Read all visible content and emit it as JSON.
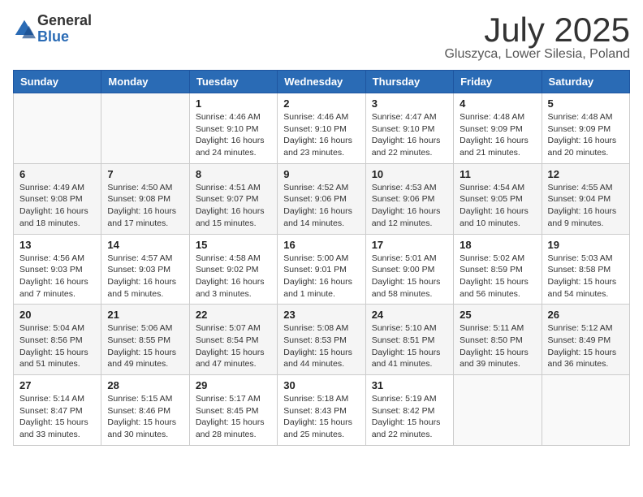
{
  "logo": {
    "general": "General",
    "blue": "Blue"
  },
  "title": "July 2025",
  "location": "Gluszyca, Lower Silesia, Poland",
  "days_of_week": [
    "Sunday",
    "Monday",
    "Tuesday",
    "Wednesday",
    "Thursday",
    "Friday",
    "Saturday"
  ],
  "weeks": [
    [
      {
        "day": "",
        "empty": true
      },
      {
        "day": "",
        "empty": true
      },
      {
        "day": "1",
        "sunrise": "4:46 AM",
        "sunset": "9:10 PM",
        "daylight": "16 hours and 24 minutes."
      },
      {
        "day": "2",
        "sunrise": "4:46 AM",
        "sunset": "9:10 PM",
        "daylight": "16 hours and 23 minutes."
      },
      {
        "day": "3",
        "sunrise": "4:47 AM",
        "sunset": "9:10 PM",
        "daylight": "16 hours and 22 minutes."
      },
      {
        "day": "4",
        "sunrise": "4:48 AM",
        "sunset": "9:09 PM",
        "daylight": "16 hours and 21 minutes."
      },
      {
        "day": "5",
        "sunrise": "4:48 AM",
        "sunset": "9:09 PM",
        "daylight": "16 hours and 20 minutes."
      }
    ],
    [
      {
        "day": "6",
        "sunrise": "4:49 AM",
        "sunset": "9:08 PM",
        "daylight": "16 hours and 18 minutes."
      },
      {
        "day": "7",
        "sunrise": "4:50 AM",
        "sunset": "9:08 PM",
        "daylight": "16 hours and 17 minutes."
      },
      {
        "day": "8",
        "sunrise": "4:51 AM",
        "sunset": "9:07 PM",
        "daylight": "16 hours and 15 minutes."
      },
      {
        "day": "9",
        "sunrise": "4:52 AM",
        "sunset": "9:06 PM",
        "daylight": "16 hours and 14 minutes."
      },
      {
        "day": "10",
        "sunrise": "4:53 AM",
        "sunset": "9:06 PM",
        "daylight": "16 hours and 12 minutes."
      },
      {
        "day": "11",
        "sunrise": "4:54 AM",
        "sunset": "9:05 PM",
        "daylight": "16 hours and 10 minutes."
      },
      {
        "day": "12",
        "sunrise": "4:55 AM",
        "sunset": "9:04 PM",
        "daylight": "16 hours and 9 minutes."
      }
    ],
    [
      {
        "day": "13",
        "sunrise": "4:56 AM",
        "sunset": "9:03 PM",
        "daylight": "16 hours and 7 minutes."
      },
      {
        "day": "14",
        "sunrise": "4:57 AM",
        "sunset": "9:03 PM",
        "daylight": "16 hours and 5 minutes."
      },
      {
        "day": "15",
        "sunrise": "4:58 AM",
        "sunset": "9:02 PM",
        "daylight": "16 hours and 3 minutes."
      },
      {
        "day": "16",
        "sunrise": "5:00 AM",
        "sunset": "9:01 PM",
        "daylight": "16 hours and 1 minute."
      },
      {
        "day": "17",
        "sunrise": "5:01 AM",
        "sunset": "9:00 PM",
        "daylight": "15 hours and 58 minutes."
      },
      {
        "day": "18",
        "sunrise": "5:02 AM",
        "sunset": "8:59 PM",
        "daylight": "15 hours and 56 minutes."
      },
      {
        "day": "19",
        "sunrise": "5:03 AM",
        "sunset": "8:58 PM",
        "daylight": "15 hours and 54 minutes."
      }
    ],
    [
      {
        "day": "20",
        "sunrise": "5:04 AM",
        "sunset": "8:56 PM",
        "daylight": "15 hours and 51 minutes."
      },
      {
        "day": "21",
        "sunrise": "5:06 AM",
        "sunset": "8:55 PM",
        "daylight": "15 hours and 49 minutes."
      },
      {
        "day": "22",
        "sunrise": "5:07 AM",
        "sunset": "8:54 PM",
        "daylight": "15 hours and 47 minutes."
      },
      {
        "day": "23",
        "sunrise": "5:08 AM",
        "sunset": "8:53 PM",
        "daylight": "15 hours and 44 minutes."
      },
      {
        "day": "24",
        "sunrise": "5:10 AM",
        "sunset": "8:51 PM",
        "daylight": "15 hours and 41 minutes."
      },
      {
        "day": "25",
        "sunrise": "5:11 AM",
        "sunset": "8:50 PM",
        "daylight": "15 hours and 39 minutes."
      },
      {
        "day": "26",
        "sunrise": "5:12 AM",
        "sunset": "8:49 PM",
        "daylight": "15 hours and 36 minutes."
      }
    ],
    [
      {
        "day": "27",
        "sunrise": "5:14 AM",
        "sunset": "8:47 PM",
        "daylight": "15 hours and 33 minutes."
      },
      {
        "day": "28",
        "sunrise": "5:15 AM",
        "sunset": "8:46 PM",
        "daylight": "15 hours and 30 minutes."
      },
      {
        "day": "29",
        "sunrise": "5:17 AM",
        "sunset": "8:45 PM",
        "daylight": "15 hours and 28 minutes."
      },
      {
        "day": "30",
        "sunrise": "5:18 AM",
        "sunset": "8:43 PM",
        "daylight": "15 hours and 25 minutes."
      },
      {
        "day": "31",
        "sunrise": "5:19 AM",
        "sunset": "8:42 PM",
        "daylight": "15 hours and 22 minutes."
      },
      {
        "day": "",
        "empty": true
      },
      {
        "day": "",
        "empty": true
      }
    ]
  ],
  "labels": {
    "sunrise": "Sunrise:",
    "sunset": "Sunset:",
    "daylight": "Daylight:"
  }
}
